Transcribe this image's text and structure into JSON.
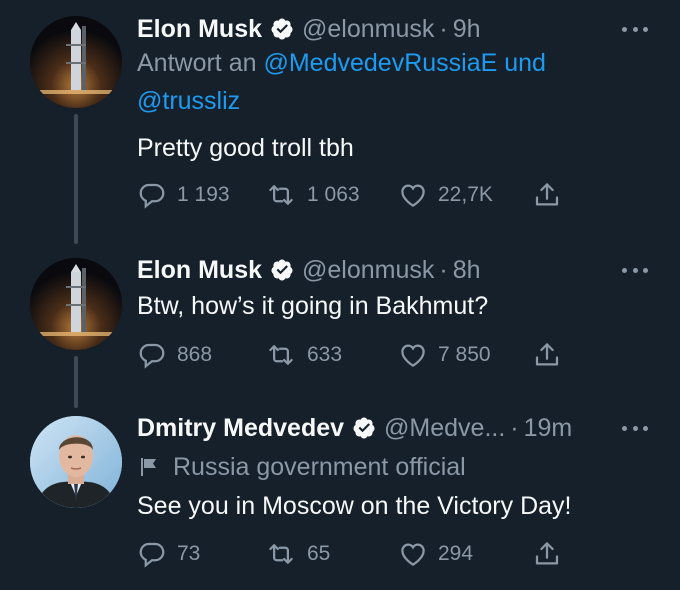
{
  "tweets": [
    {
      "name": "Elon Musk",
      "handle": "@elonmusk",
      "separator": "·",
      "time": "9h",
      "reply_prefix": "Antwort an",
      "reply_mention1": "@MedvedevRussiaE",
      "reply_conj": "und",
      "reply_mention2": "@trussliz",
      "text": "Pretty good troll tbh",
      "replies": "1 193",
      "retweets": "1 063",
      "likes": "22,7K",
      "verified": true,
      "avatar_icon": "rocket-launch-avatar"
    },
    {
      "name": "Elon Musk",
      "handle": "@elonmusk",
      "separator": "·",
      "time": "8h",
      "text": "Btw, how’s it going in Bakhmut?",
      "replies": "868",
      "retweets": "633",
      "likes": "7 850",
      "verified": true,
      "avatar_icon": "rocket-launch-avatar"
    },
    {
      "name": "Dmitry Medvedev",
      "handle": "@Medve...",
      "separator": "·",
      "time": "19m",
      "label": "Russia government official",
      "text": "See you in Moscow on the Victory Day!",
      "replies": "73",
      "retweets": "65",
      "likes": "294",
      "verified": true,
      "avatar_icon": "person-portrait-avatar"
    }
  ],
  "colors": {
    "background": "#15202b",
    "text": "#f7f9f9",
    "muted": "#8b98a5",
    "link": "#1d9bf0",
    "thread_line": "#3d4a56"
  }
}
